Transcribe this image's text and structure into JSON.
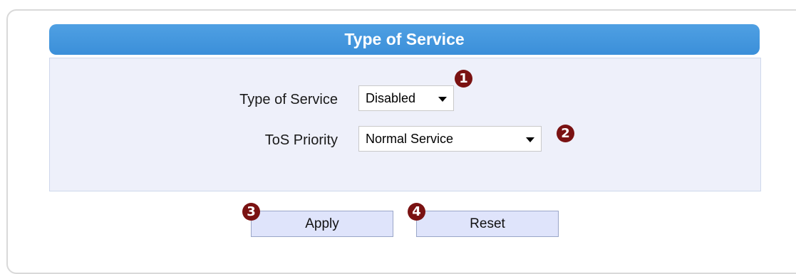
{
  "panel": {
    "title": "Type of Service"
  },
  "form": {
    "type_of_service": {
      "label": "Type of Service",
      "value": "Disabled"
    },
    "tos_priority": {
      "label": "ToS Priority",
      "value": "Normal Service"
    }
  },
  "buttons": {
    "apply_label": "Apply",
    "reset_label": "Reset"
  },
  "callouts": [
    "1",
    "2",
    "3",
    "4"
  ],
  "colors": {
    "header_blue": "#3b8fd9",
    "panel_bg": "#eef0fa",
    "callout": "#7a1212",
    "button_bg": "#dfe4fb"
  }
}
